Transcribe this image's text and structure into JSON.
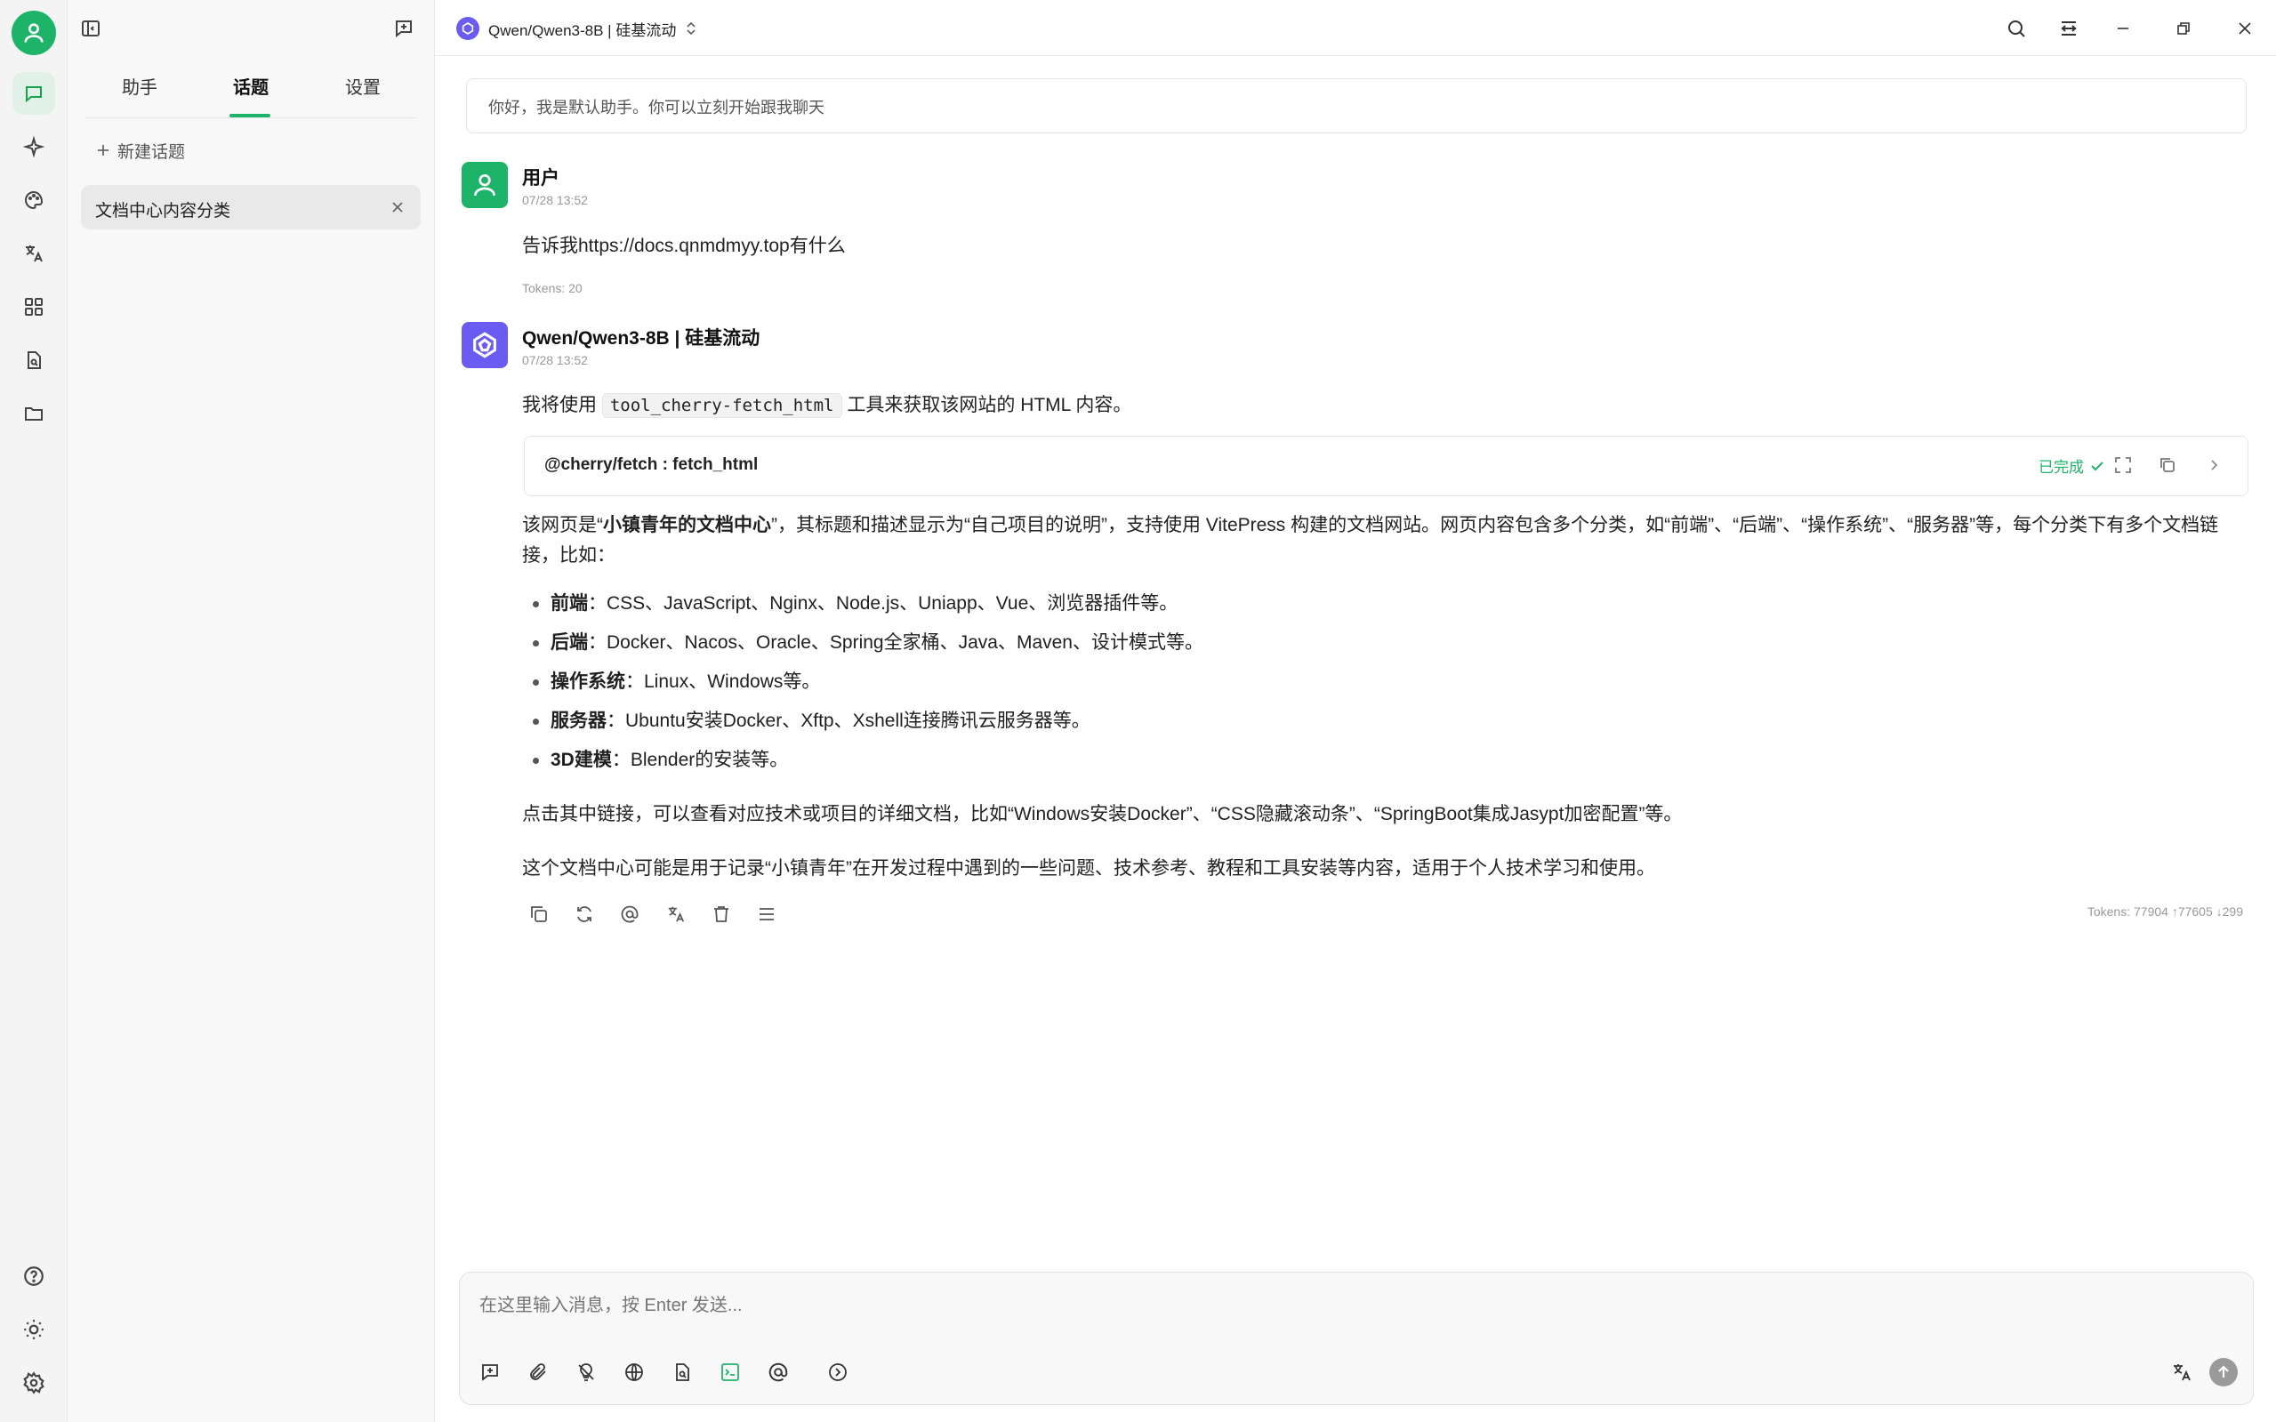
{
  "header": {
    "model_title": "Qwen/Qwen3-8B | 硅基流动"
  },
  "sidebar": {
    "tabs": [
      "助手",
      "话题",
      "设置"
    ],
    "new_topic": "新建话题",
    "topics": [
      "文档中心内容分类"
    ]
  },
  "chat": {
    "greeting": "你好，我是默认助手。你可以立刻开始跟我聊天",
    "user": {
      "name": "用户",
      "time": "07/28 13:52",
      "text": "告诉我https://docs.qnmdmyy.top有什么",
      "tokens": "Tokens: 20"
    },
    "assistant": {
      "name": "Qwen/Qwen3-8B | 硅基流动",
      "time": "07/28 13:52",
      "intro_before": "我将使用",
      "intro_code": "tool_cherry-fetch_html",
      "intro_after": "工具来获取该网站的 HTML 内容。",
      "tool_call": {
        "name": "@cherry/fetch : fetch_html",
        "status": "已完成"
      },
      "para1_a": "该网页是“",
      "para1_bold": "小镇青年的文档中心",
      "para1_b": "”，其标题和描述显示为“自己项目的说明”，支持使用 VitePress 构建的文档网站。网页内容包含多个分类，如“前端”、“后端”、“操作系统”、“服务器”等，每个分类下有多个文档链接，比如：",
      "bullets": [
        {
          "label": "前端",
          "text": "：CSS、JavaScript、Nginx、Node.js、Uniapp、Vue、浏览器插件等。"
        },
        {
          "label": "后端",
          "text": "：Docker、Nacos、Oracle、Spring全家桶、Java、Maven、设计模式等。"
        },
        {
          "label": "操作系统",
          "text": "：Linux、Windows等。"
        },
        {
          "label": "服务器",
          "text": "：Ubuntu安装Docker、Xftp、Xshell连接腾讯云服务器等。"
        },
        {
          "label": "3D建模",
          "text": "：Blender的安装等。"
        }
      ],
      "para2": "点击其中链接，可以查看对应技术或项目的详细文档，比如“Windows安装Docker”、“CSS隐藏滚动条”、“SpringBoot集成Jasypt加密配置”等。",
      "para3": "这个文档中心可能是用于记录“小镇青年”在开发过程中遇到的一些问题、技术参考、教程和工具安装等内容，适用于个人技术学习和使用。",
      "tokens": "Tokens: 77904 ↑77605 ↓299"
    }
  },
  "input": {
    "placeholder": "在这里输入消息，按 Enter 发送..."
  },
  "colors": {
    "accent": "#1db469",
    "model_icon": "#6a5cf0"
  }
}
